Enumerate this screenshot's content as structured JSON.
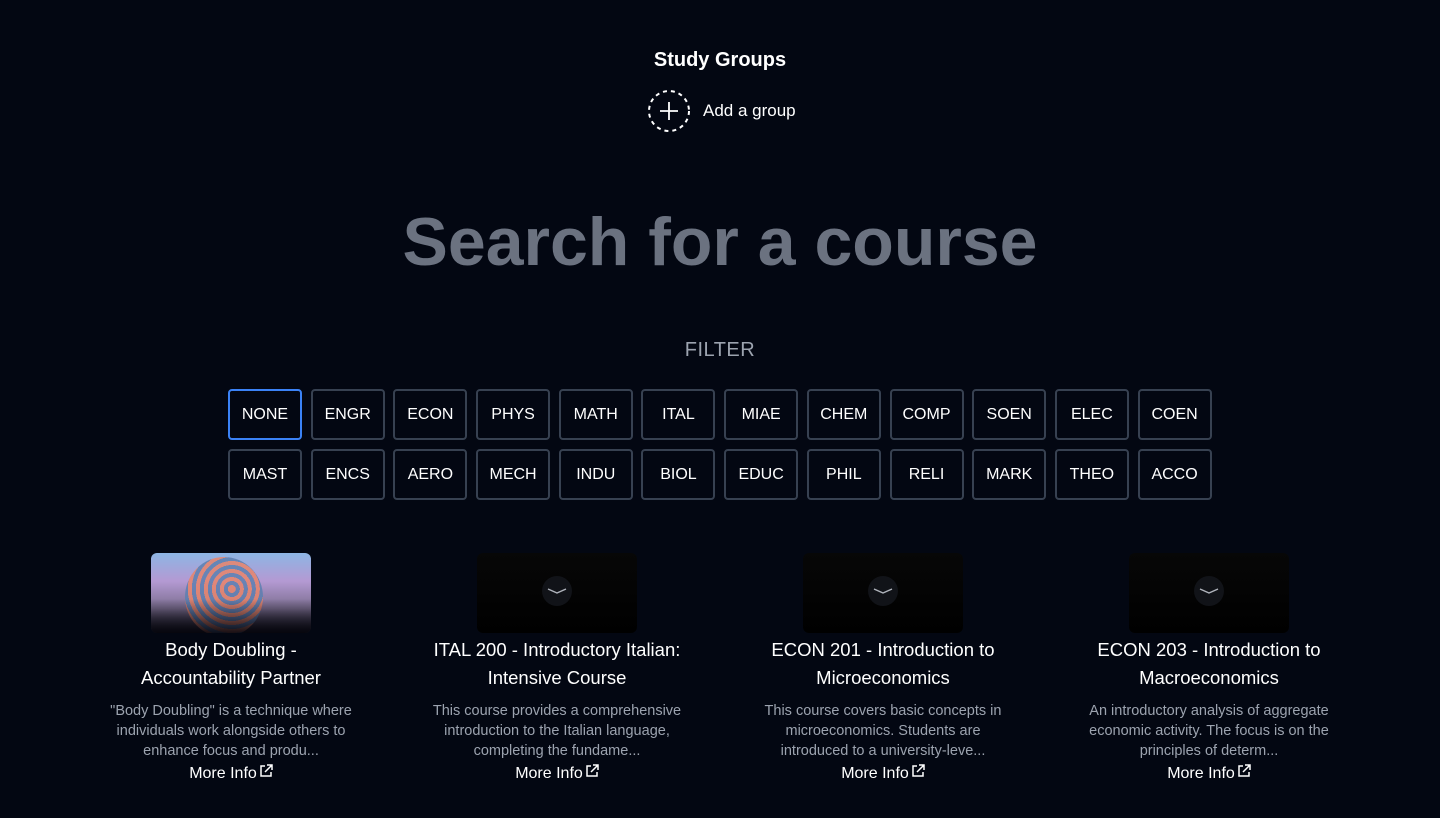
{
  "header": {
    "title": "Study Groups",
    "add_group_label": "Add a group",
    "add_icon": "plus-circle-dashed-icon"
  },
  "search": {
    "placeholder": "Search for a course",
    "value": ""
  },
  "filter": {
    "heading": "FILTER",
    "selected": "NONE",
    "options": [
      "NONE",
      "ENGR",
      "ECON",
      "PHYS",
      "MATH",
      "ITAL",
      "MIAE",
      "CHEM",
      "COMP",
      "SOEN",
      "ELEC",
      "COEN",
      "MAST",
      "ENCS",
      "AERO",
      "MECH",
      "INDU",
      "BIOL",
      "EDUC",
      "PHIL",
      "RELI",
      "MARK",
      "THEO",
      "ACCO"
    ]
  },
  "cards": [
    {
      "title_line1": "Body Doubling -",
      "title_line2": "Accountability Partner",
      "description": "\"Body Doubling\" is a technique where individuals work alongside others to enhance focus and produ...",
      "link_label": "More Info",
      "thumbnail": "abstract-sculpture-image"
    },
    {
      "title_line1": "ITAL 200 - Introductory Italian:",
      "title_line2": "Intensive Course",
      "description": "This course provides a comprehensive introduction to the Italian language, completing the fundame...",
      "link_label": "More Info",
      "thumbnail": "placeholder-chevron-icon"
    },
    {
      "title_line1": "ECON 201 - Introduction to",
      "title_line2": "Microeconomics",
      "description": "This course covers basic concepts in microeconomics. Students are introduced to a university-leve...",
      "link_label": "More Info",
      "thumbnail": "placeholder-chevron-icon"
    },
    {
      "title_line1": "ECON 203 - Introduction to",
      "title_line2": "Macroeconomics",
      "description": "An introductory analysis of aggregate economic activity. The focus is on the principles of determ...",
      "link_label": "More Info",
      "thumbnail": "placeholder-chevron-icon"
    }
  ],
  "colors": {
    "background": "#030712",
    "accent": "#3b82f6",
    "border": "#374151",
    "muted_text": "#9ca3af",
    "placeholder_text": "#6b7280"
  }
}
